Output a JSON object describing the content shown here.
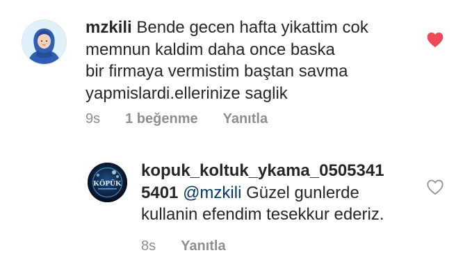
{
  "comments": [
    {
      "username": "mzkili",
      "text": "Bende gecen hafta yikattim cok memnun kaldim daha once baska bir firmaya vermistim baştan savma yapmislardi.ellerinize saglik",
      "lines": [
        "Bende gecen hafta yikattim cok",
        "memnun kaldim daha once baska",
        "bir firmaya vermistim baştan savma",
        "yapmislardi.ellerinize saglik"
      ],
      "time": "9s",
      "likes": "1 beğenme",
      "reply_label": "Yanıtla",
      "liked": true,
      "heart_color": "#ed4956",
      "avatar_icon": "hijab-woman-avatar-icon"
    },
    {
      "username": "kopuk_koltuk_ykama_0505341",
      "username_cont": "5401",
      "mention": "@mzkili",
      "text_after_mention": " Güzel gunlerde",
      "line3": "kullanin efendim tesekkur ederiz.",
      "time": "8s",
      "reply_label": "Yanıtla",
      "liked": false,
      "avatar_logo_text": "KÖPÜK",
      "avatar_icon": "kopuk-logo-avatar-icon"
    }
  ]
}
